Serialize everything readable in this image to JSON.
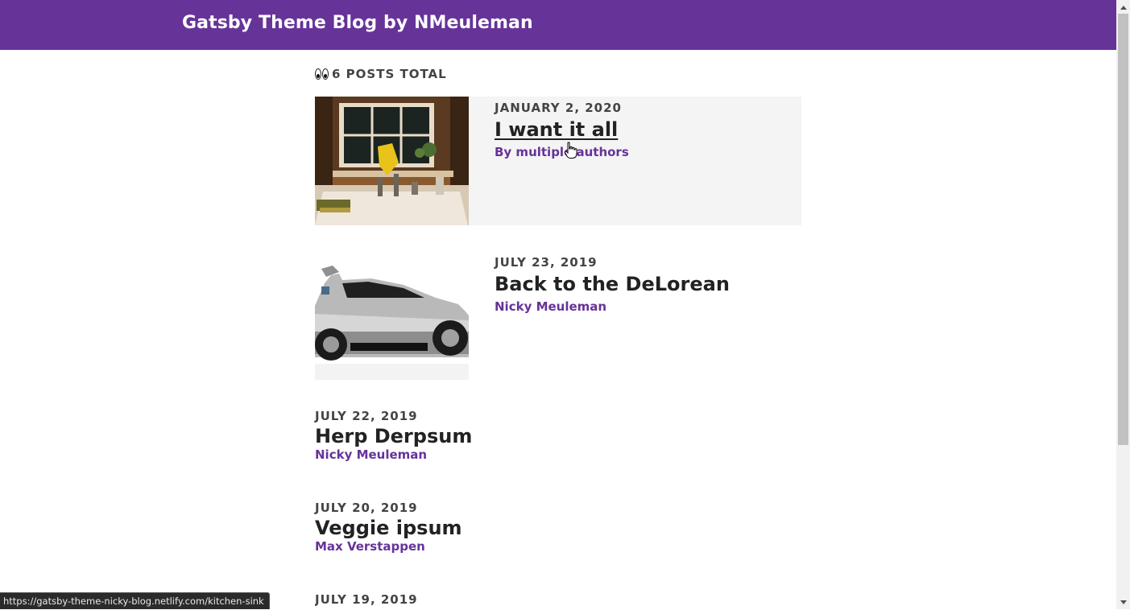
{
  "header": {
    "site_title": "Gatsby Theme Blog by NMeuleman",
    "bg_color": "#663399"
  },
  "summary": {
    "icon": "eyes-emoji-icon",
    "label": "6 POSTS TOTAL"
  },
  "posts": [
    {
      "date": "JANUARY 2, 2020",
      "title": "I want it all",
      "author": "By multiple authors",
      "has_image": true,
      "image": "kitchen-sink-photo",
      "hovered": true
    },
    {
      "date": "JULY 23, 2019",
      "title": "Back to the DeLorean",
      "author": "Nicky Meuleman",
      "has_image": true,
      "image": "delorean-photo"
    },
    {
      "date": "JULY 22, 2019",
      "title": "Herp Derpsum",
      "author": "Nicky Meuleman",
      "has_image": false
    },
    {
      "date": "JULY 20, 2019",
      "title": "Veggie ipsum",
      "author": "Max Verstappen",
      "has_image": false
    },
    {
      "date": "JULY 19, 2019",
      "has_image": false
    }
  ],
  "status_bar": {
    "url": "https://gatsby-theme-nicky-blog.netlify.com/kitchen-sink"
  },
  "colors": {
    "accent": "#663399",
    "hover_bg": "#f4f4f4",
    "text": "#222222"
  }
}
